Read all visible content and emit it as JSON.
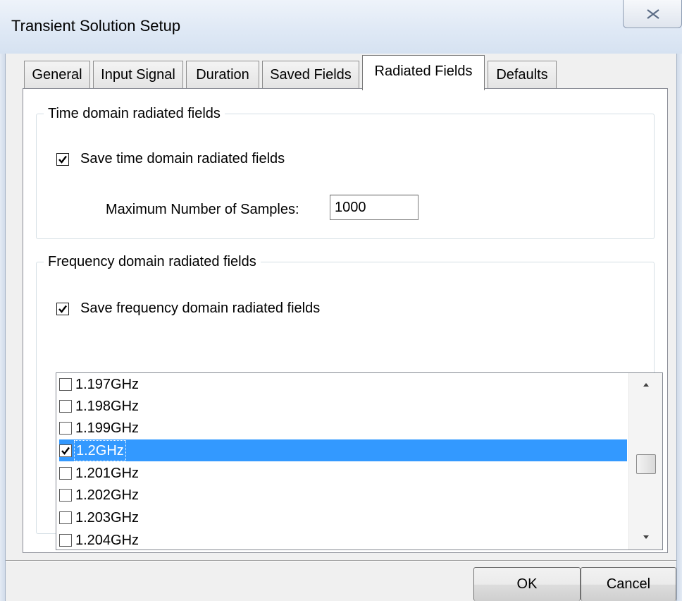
{
  "window": {
    "title": "Transient Solution Setup"
  },
  "tabs": [
    {
      "label": "General",
      "active": false
    },
    {
      "label": "Input Signal",
      "active": false
    },
    {
      "label": "Duration",
      "active": false
    },
    {
      "label": "Saved Fields",
      "active": false
    },
    {
      "label": "Radiated Fields",
      "active": true
    },
    {
      "label": "Defaults",
      "active": false
    }
  ],
  "time_domain": {
    "legend": "Time domain radiated fields",
    "save_label": "Save time domain radiated fields",
    "save_checked": true,
    "max_samples_label": "Maximum Number of Samples:",
    "max_samples_value": "1000"
  },
  "frequency_domain": {
    "legend": "Frequency domain radiated fields",
    "save_label": "Save frequency domain radiated fields",
    "save_checked": true,
    "frequencies": [
      {
        "label": "1.197GHz",
        "checked": false,
        "selected": false
      },
      {
        "label": "1.198GHz",
        "checked": false,
        "selected": false
      },
      {
        "label": "1.199GHz",
        "checked": false,
        "selected": false
      },
      {
        "label": "1.2GHz",
        "checked": true,
        "selected": true
      },
      {
        "label": "1.201GHz",
        "checked": false,
        "selected": false
      },
      {
        "label": "1.202GHz",
        "checked": false,
        "selected": false
      },
      {
        "label": "1.203GHz",
        "checked": false,
        "selected": false
      },
      {
        "label": "1.204GHz",
        "checked": false,
        "selected": false
      }
    ]
  },
  "buttons": {
    "ok": "OK",
    "cancel": "Cancel"
  },
  "colors": {
    "selection": "#3399ff",
    "client_background": "#f0f0f0"
  }
}
